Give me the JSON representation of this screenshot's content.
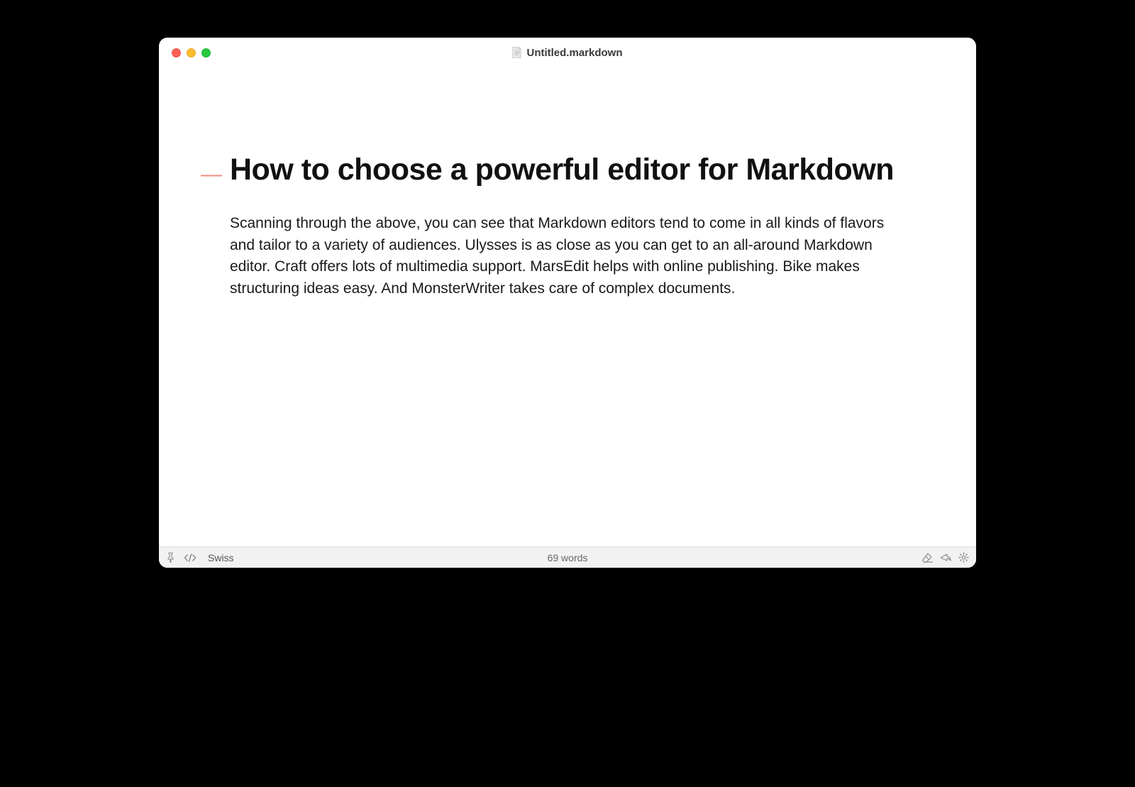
{
  "titlebar": {
    "filename": "Untitled.markdown"
  },
  "document": {
    "heading_marker": "—",
    "heading": "How to choose a powerful editor for Markdown",
    "paragraph": "Scanning through the above, you can see that Markdown editors tend to come in all kinds of flavors and tailor to a variety of audiences. Ulysses is as close as you can get to an all-around Markdown editor. Craft offers lots of multimedia support. MarsEdit helps with online publishing. Bike makes structuring ideas easy. And MonsterWriter takes care of complex documents."
  },
  "statusbar": {
    "theme": "Swiss",
    "word_count": "69 words"
  },
  "colors": {
    "heading_marker": "#f28b82",
    "traffic_red": "#ff5f57",
    "traffic_yellow": "#febc2e",
    "traffic_green": "#28c840"
  }
}
